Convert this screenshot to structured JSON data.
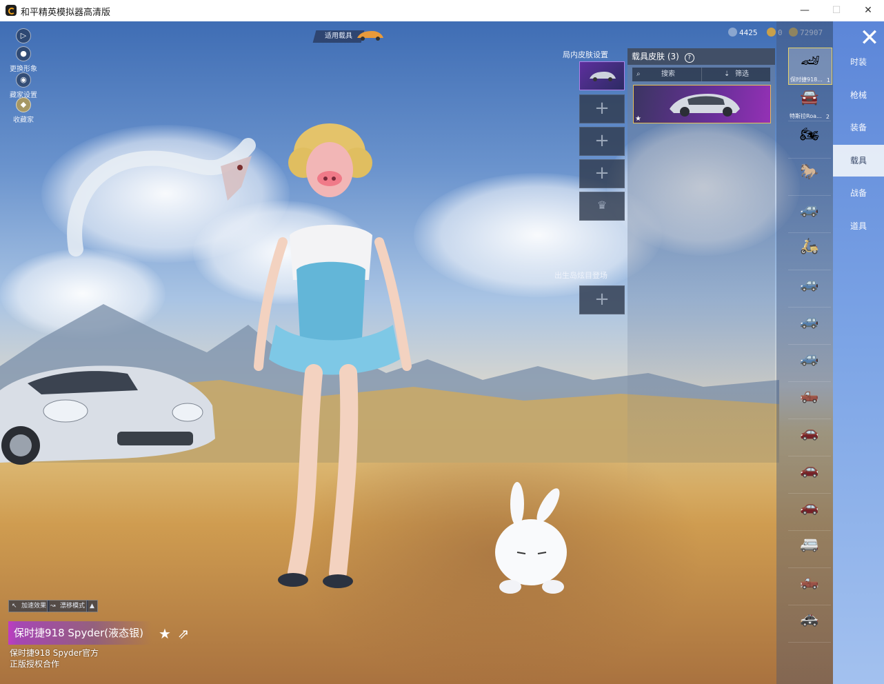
{
  "window": {
    "title": "和平精英模拟器高清版",
    "min_glyph": "—",
    "max_glyph": "☐",
    "close_glyph": "✕"
  },
  "left_top": {
    "play_glyph": "▷",
    "change_look": "更换形象",
    "hide_ui": "藏家设置",
    "collect": "收藏家"
  },
  "top": {
    "applicable_vehicle": "适用载具",
    "currencies": [
      {
        "value": "4425",
        "color": "#8aa6cf"
      },
      {
        "value": "0",
        "color": "#c9a04a"
      },
      {
        "value": "72907",
        "color": "#e6b637"
      }
    ]
  },
  "skin_settings": {
    "title": "局内皮肤设置",
    "spawn_title": "出生岛炫目登场",
    "plus_glyph": "+"
  },
  "vehicle_panel": {
    "title": "载具皮肤 (3)",
    "help_glyph": "?",
    "search_label": "搜索",
    "filter_label": "筛选",
    "card_star": "★"
  },
  "vehicle_list": [
    {
      "label": "保时捷918...",
      "count": "1",
      "icon": "sports-car-icon"
    },
    {
      "label": "特斯拉Roa...",
      "count": "2",
      "icon": "roadster-icon"
    },
    {
      "label": "",
      "count": "",
      "icon": "motorcycle-icon"
    },
    {
      "label": "",
      "count": "",
      "icon": "horse-icon"
    },
    {
      "label": "",
      "count": "",
      "icon": "buggy-icon"
    },
    {
      "label": "",
      "count": "",
      "icon": "scooter-icon"
    },
    {
      "label": "",
      "count": "",
      "icon": "jeep-icon"
    },
    {
      "label": "",
      "count": "",
      "icon": "jeep-covered-icon"
    },
    {
      "label": "",
      "count": "",
      "icon": "jeep-open-icon"
    },
    {
      "label": "",
      "count": "",
      "icon": "monster-truck-icon"
    },
    {
      "label": "",
      "count": "",
      "icon": "coupe-icon"
    },
    {
      "label": "",
      "count": "",
      "icon": "sedan-icon"
    },
    {
      "label": "",
      "count": "",
      "icon": "sedan-white-icon"
    },
    {
      "label": "",
      "count": "",
      "icon": "van-icon"
    },
    {
      "label": "",
      "count": "",
      "icon": "pickup-icon"
    },
    {
      "label": "",
      "count": "",
      "icon": "rally-car-icon"
    }
  ],
  "categories": [
    {
      "label": "时装",
      "active": false
    },
    {
      "label": "枪械",
      "active": false
    },
    {
      "label": "装备",
      "active": false
    },
    {
      "label": "载具",
      "active": true
    },
    {
      "label": "战备",
      "active": false
    },
    {
      "label": "道具",
      "active": false
    }
  ],
  "bottom_left": {
    "accelerate": "加速效果",
    "drift": "漂移模式",
    "vehicle_name": "保时捷918 Spyder(液态银)",
    "official_line1": "保时捷918 Spyder官方",
    "official_line2": "正版授权合作"
  },
  "close_glyph": "✕"
}
